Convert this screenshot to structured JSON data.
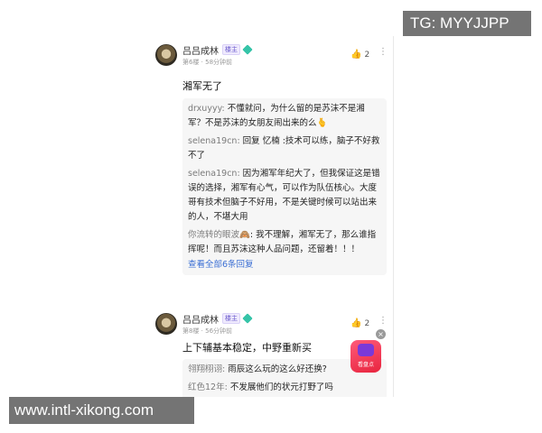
{
  "watermarks": {
    "top_right": "TG: MYYJJPP",
    "bottom_left": "www.intl-xikong.com"
  },
  "comments": [
    {
      "user": "吕吕成林",
      "badge": "楼主",
      "meta": "第6楼 · 58分钟前",
      "likes": "2",
      "text": "湘军无了",
      "replies": [
        {
          "user": "drxuyyy:",
          "text": " 不懂就问，为什么留的是苏沫不是湘军？不是苏沫的女朋友闹出来的么",
          "emoji": "🫰"
        },
        {
          "user": "selena19cn:",
          "text": " 回复 忆楠 :技术可以练，脑子不好救不了"
        },
        {
          "user": "selena19cn:",
          "text": " 因为湘军年纪大了，但我保证这是错误的选择，湘军有心气，可以作为队伍核心。大度哥有技术但脑子不好用，不是关键时候可以站出来的人，不堪大用"
        },
        {
          "user": "你流转的眼波",
          "emoji": "🙈",
          "text": ": 我不理解，湘军无了，那么谁指挥呢！而且苏沫这种人品问题，还留着！！！"
        }
      ],
      "view_all": "查看全部6条回复"
    },
    {
      "user": "吕吕成林",
      "badge": "楼主",
      "meta": "第8楼 · 56分钟前",
      "likes": "2",
      "text": "上下辅基本稳定，中野重新买",
      "replies": [
        {
          "user": "翎翔栩诩:",
          "text": " 雨辰这么玩的这么好还换?"
        },
        {
          "user": "红色12年:",
          "text": " 不发展他们的状元打野了吗"
        }
      ]
    }
  ],
  "floating_app": {
    "label": "看盘点",
    "close": "×"
  },
  "icons": {
    "like": "thumb-up-icon",
    "more": "more-vertical-icon",
    "vip": "diamond-icon"
  },
  "colors": {
    "link": "#3b6fd4",
    "reply_bg": "#f6f6f6",
    "badge": "#6a5acd"
  }
}
